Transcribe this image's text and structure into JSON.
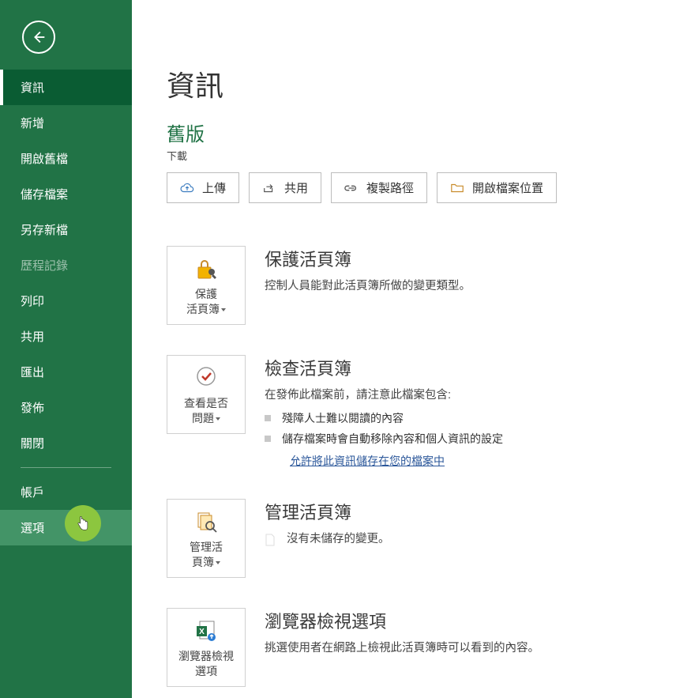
{
  "colors": {
    "brand": "#217346"
  },
  "sidebar": {
    "items": [
      {
        "label": "資訊",
        "state": "active"
      },
      {
        "label": "新增"
      },
      {
        "label": "開啟舊檔"
      },
      {
        "label": "儲存檔案"
      },
      {
        "label": "另存新檔"
      },
      {
        "label": "歷程記錄",
        "state": "disabled"
      },
      {
        "label": "列印"
      },
      {
        "label": "共用"
      },
      {
        "label": "匯出"
      },
      {
        "label": "發佈"
      },
      {
        "label": "關閉"
      }
    ],
    "footer": [
      {
        "label": "帳戶"
      },
      {
        "label": "選項",
        "state": "hovered"
      }
    ]
  },
  "page": {
    "title": "資訊",
    "version": "舊版",
    "download": "下載"
  },
  "actions": {
    "upload": "上傳",
    "share": "共用",
    "copy_path": "複製路徑",
    "open_location": "開啟檔案位置"
  },
  "sections": {
    "protect": {
      "tile": "保護\n活頁簿",
      "title": "保護活頁簿",
      "desc": "控制人員能對此活頁簿所做的變更類型。"
    },
    "inspect": {
      "tile": "查看是否\n問題",
      "title": "檢查活頁簿",
      "intro": "在發佈此檔案前，請注意此檔案包含:",
      "bullets": [
        "殘障人士難以閱讀的內容",
        "儲存檔案時會自動移除內容和個人資訊的設定"
      ],
      "link": "允許將此資訊儲存在您的檔案中"
    },
    "manage": {
      "tile": "管理活\n頁簿",
      "title": "管理活頁簿",
      "no_changes": "沒有未儲存的變更。"
    },
    "browser": {
      "tile": "瀏覽器檢視\n選項",
      "title": "瀏覽器檢視選項",
      "desc": "挑選使用者在網路上檢視此活頁簿時可以看到的內容。"
    }
  }
}
